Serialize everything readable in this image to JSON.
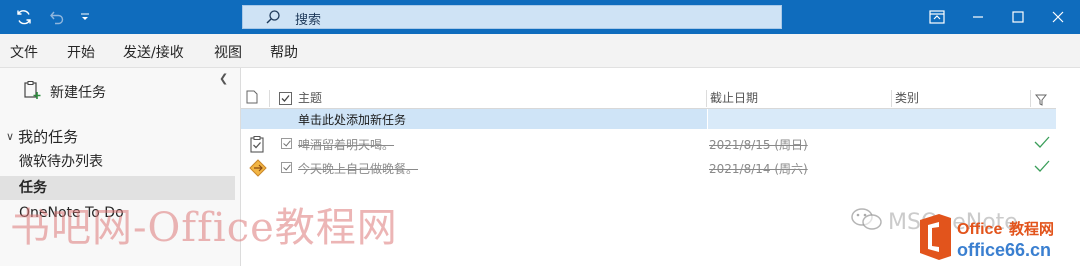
{
  "titlebar": {
    "search_placeholder": "搜索",
    "background_color": "#0f6cbd",
    "icons": [
      "sync-icon",
      "undo-icon",
      "quick-access-dropdown-icon",
      "ribbon-display-icon",
      "minimize-icon",
      "maximize-icon",
      "close-icon"
    ]
  },
  "menu": {
    "items": [
      "文件",
      "开始",
      "发送/接收",
      "视图",
      "帮助"
    ]
  },
  "sidebar": {
    "new_task_label": "新建任务",
    "group_label": "我的任务",
    "folders": [
      "微软待办列表",
      "任务",
      "OneNote To Do"
    ],
    "selected_folder": "任务"
  },
  "task_list": {
    "columns": {
      "subject": "主题",
      "due_date": "截止日期",
      "category": "类别"
    },
    "add_new_placeholder": "单击此处添加新任务",
    "tasks": [
      {
        "subject": "啤酒留着明天喝。",
        "due": "2021/8/15 (周日)",
        "completed": true,
        "icon": "task-icon"
      },
      {
        "subject": "今天晚上自己做晚餐。",
        "due": "2021/8/14 (周六)",
        "completed": true,
        "icon": "assigned-task-icon"
      }
    ]
  },
  "watermarks": {
    "main": "书吧网-Office教程网",
    "wechat": "MSOneNote",
    "logo_brand": "Office教程网",
    "logo_url": "office66.cn"
  }
}
